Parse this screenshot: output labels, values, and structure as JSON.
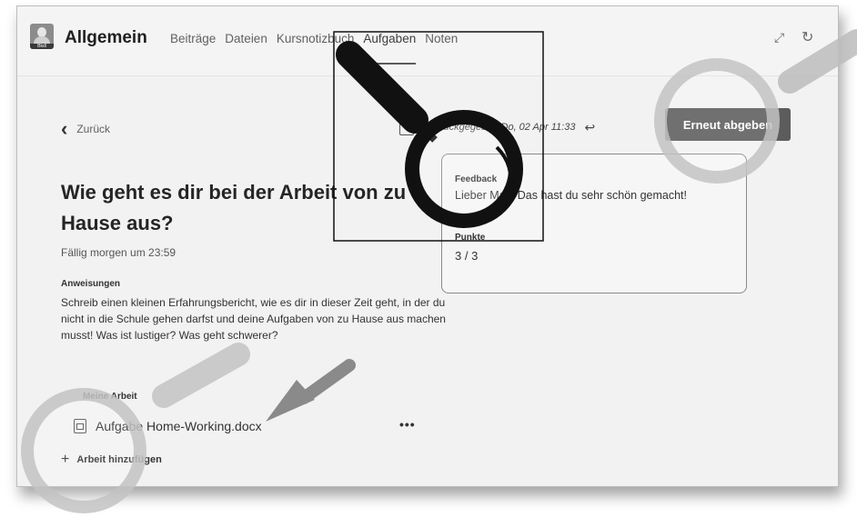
{
  "header": {
    "channel": "Allgemein",
    "tabs": [
      "Beiträge",
      "Dateien",
      "Kursnotizbuch",
      "Aufgaben",
      "Noten"
    ],
    "active_tab": "Aufgaben"
  },
  "nav": {
    "back_label": "Zurück"
  },
  "assignment": {
    "title": "Wie geht es dir bei der Arbeit von zu Hause aus?",
    "due": "Fällig morgen um 23:59",
    "instructions_label": "Anweisungen",
    "instructions": "Schreib einen kleinen Erfahrungsbericht, wie es dir in dieser Zeit geht, in der du nicht in die Schule gehen darfst und deine Aufgaben von zu Hause aus machen musst! Was ist lustiger? Was geht schwerer?",
    "my_work_label": "Meine Arbeit",
    "attachment": "Aufgabe Home-Working.docx",
    "more": "•••",
    "add_work": "Arbeit hinzufügen"
  },
  "status": {
    "returned": "Zurückgegeben Do, 02 Apr 11:33",
    "resubmit": "Erneut abgeben"
  },
  "feedback": {
    "label": "Feedback",
    "text": "Lieber Max, Das hast du sehr schön gemacht!",
    "points_label": "Punkte",
    "points": "3 / 3"
  },
  "icons": [
    "avatar-icon",
    "expand-icon",
    "refresh-icon",
    "chevron-left-icon",
    "download-icon",
    "return-arrow-icon",
    "word-doc-icon",
    "plus-icon",
    "magnifier-icon",
    "pointer-arrow-icon"
  ]
}
